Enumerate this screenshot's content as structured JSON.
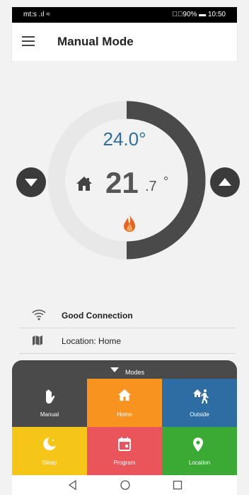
{
  "status_bar": {
    "carrier": "mt:s .ıl ≈",
    "right": "▯⃢90% ▬ 10:50"
  },
  "app_bar": {
    "title": "Manual Mode"
  },
  "thermostat": {
    "setpoint": "24.0°",
    "current_integer": "21",
    "current_decimal": ".7",
    "current_degree": "°",
    "dial_progress": 0.5,
    "colors": {
      "dial_fill": "#4a4a4a",
      "dial_track": "#e8e8e8",
      "setpoint_text": "#2c6fa3",
      "flame": "#e8641e"
    }
  },
  "status_rows": [
    {
      "icon": "wifi-icon",
      "text": "Good Connection"
    },
    {
      "icon": "map-icon",
      "text": "Location: Home"
    }
  ],
  "modes": {
    "toggle_label": "Modes",
    "tiles": [
      {
        "id": "manual",
        "label": "Manual",
        "icon": "hand-icon",
        "color": "#4a4a4a"
      },
      {
        "id": "home",
        "label": "Home",
        "icon": "home-icon",
        "color": "#f7931e"
      },
      {
        "id": "outside",
        "label": "Outside",
        "icon": "walking-icon",
        "color": "#2e6da4"
      },
      {
        "id": "sleep",
        "label": "Sleep",
        "icon": "moon-icon",
        "color": "#f5c518"
      },
      {
        "id": "program",
        "label": "Program",
        "icon": "calendar-icon",
        "color": "#e9555b"
      },
      {
        "id": "location",
        "label": "Location",
        "icon": "location-pin-icon",
        "color": "#3aaa35"
      }
    ]
  }
}
